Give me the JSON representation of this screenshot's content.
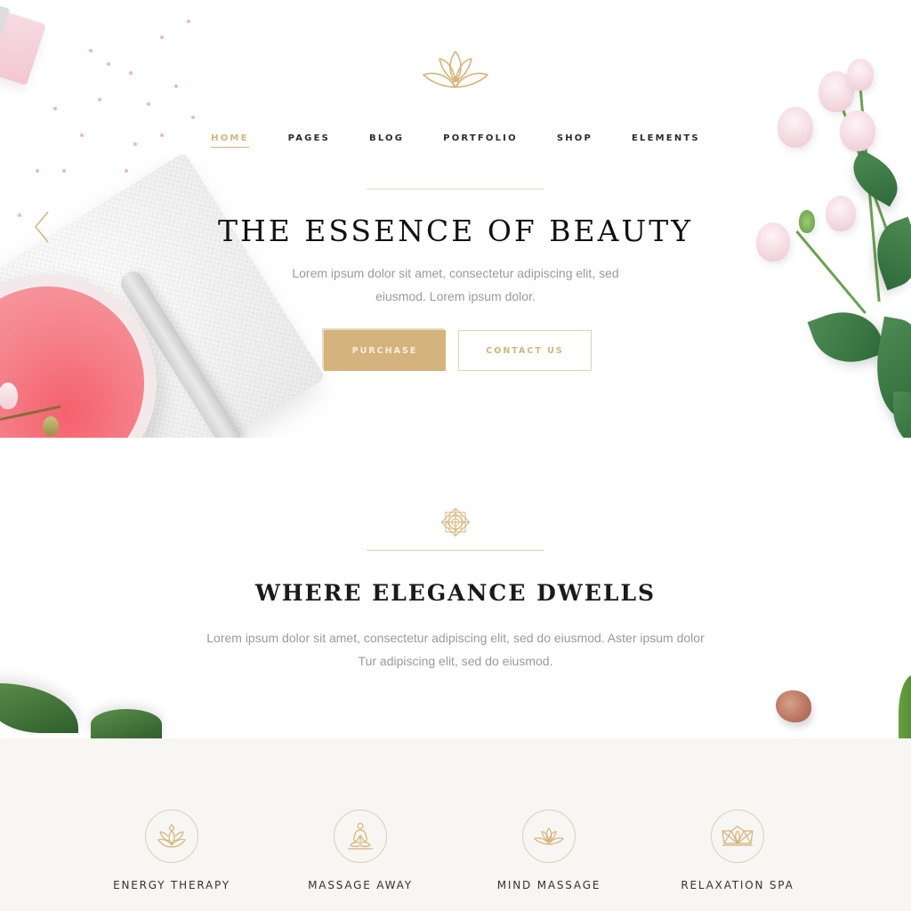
{
  "brand": {
    "logo_icon": "lotus-logo-icon",
    "accent_color": "#d4b47c"
  },
  "nav": {
    "items": [
      {
        "label": "HOME",
        "active": true
      },
      {
        "label": "PAGES",
        "active": false
      },
      {
        "label": "BLOG",
        "active": false
      },
      {
        "label": "PORTFOLIO",
        "active": false
      },
      {
        "label": "SHOP",
        "active": false
      },
      {
        "label": "ELEMENTS",
        "active": false
      }
    ]
  },
  "hero": {
    "title": "THE ESSENCE OF BEAUTY",
    "text": "Lorem ipsum dolor sit amet, consectetur adipiscing elit, sed eiusmod. Lorem ipsum dolor.",
    "purchase_label": "PURCHASE",
    "contact_label": "CONTACT US",
    "prev_icon": "chevron-left-icon"
  },
  "intro": {
    "icon": "mandala-icon",
    "title": "WHERE ELEGANCE DWELLS",
    "text": "Lorem ipsum dolor sit amet, consectetur adipiscing elit, sed do eiusmod. Aster ipsum dolor Tur adipiscing elit, sed do eiusmod."
  },
  "services": [
    {
      "label": "ENERGY THERAPY",
      "icon": "lotus-yoga-icon"
    },
    {
      "label": "MASSAGE AWAY",
      "icon": "meditation-icon"
    },
    {
      "label": "MIND MASSAGE",
      "icon": "lotus-icon"
    },
    {
      "label": "RELAXATION SPA",
      "icon": "geometric-lotus-icon"
    }
  ]
}
